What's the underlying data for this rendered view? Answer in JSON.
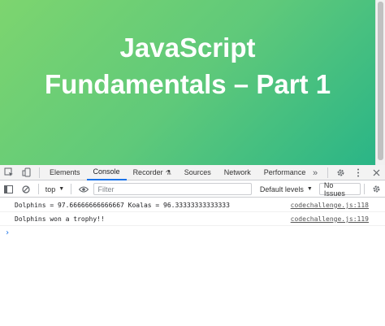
{
  "page": {
    "heading": "JavaScript\nFundamentals – Part 1"
  },
  "devtools": {
    "tabs": [
      "Elements",
      "Console",
      "Recorder",
      "Sources",
      "Network",
      "Performance"
    ],
    "active_tab": "Console",
    "more_tabs": "»",
    "toolbar": {
      "context": "top",
      "filter_placeholder": "Filter",
      "levels": "Default levels",
      "issues": "No Issues"
    },
    "logs": [
      {
        "message": "Dolphins = 97.66666666666667 Koalas = 96.33333333333333",
        "source": "codechallenge.js:118"
      },
      {
        "message": "Dolphins won a trophy!!",
        "source": "codechallenge.js:119"
      }
    ],
    "prompt": "›"
  },
  "colors": {
    "gradient_start": "#7dd56f",
    "gradient_end": "#28b487",
    "accent": "#1a73e8"
  }
}
